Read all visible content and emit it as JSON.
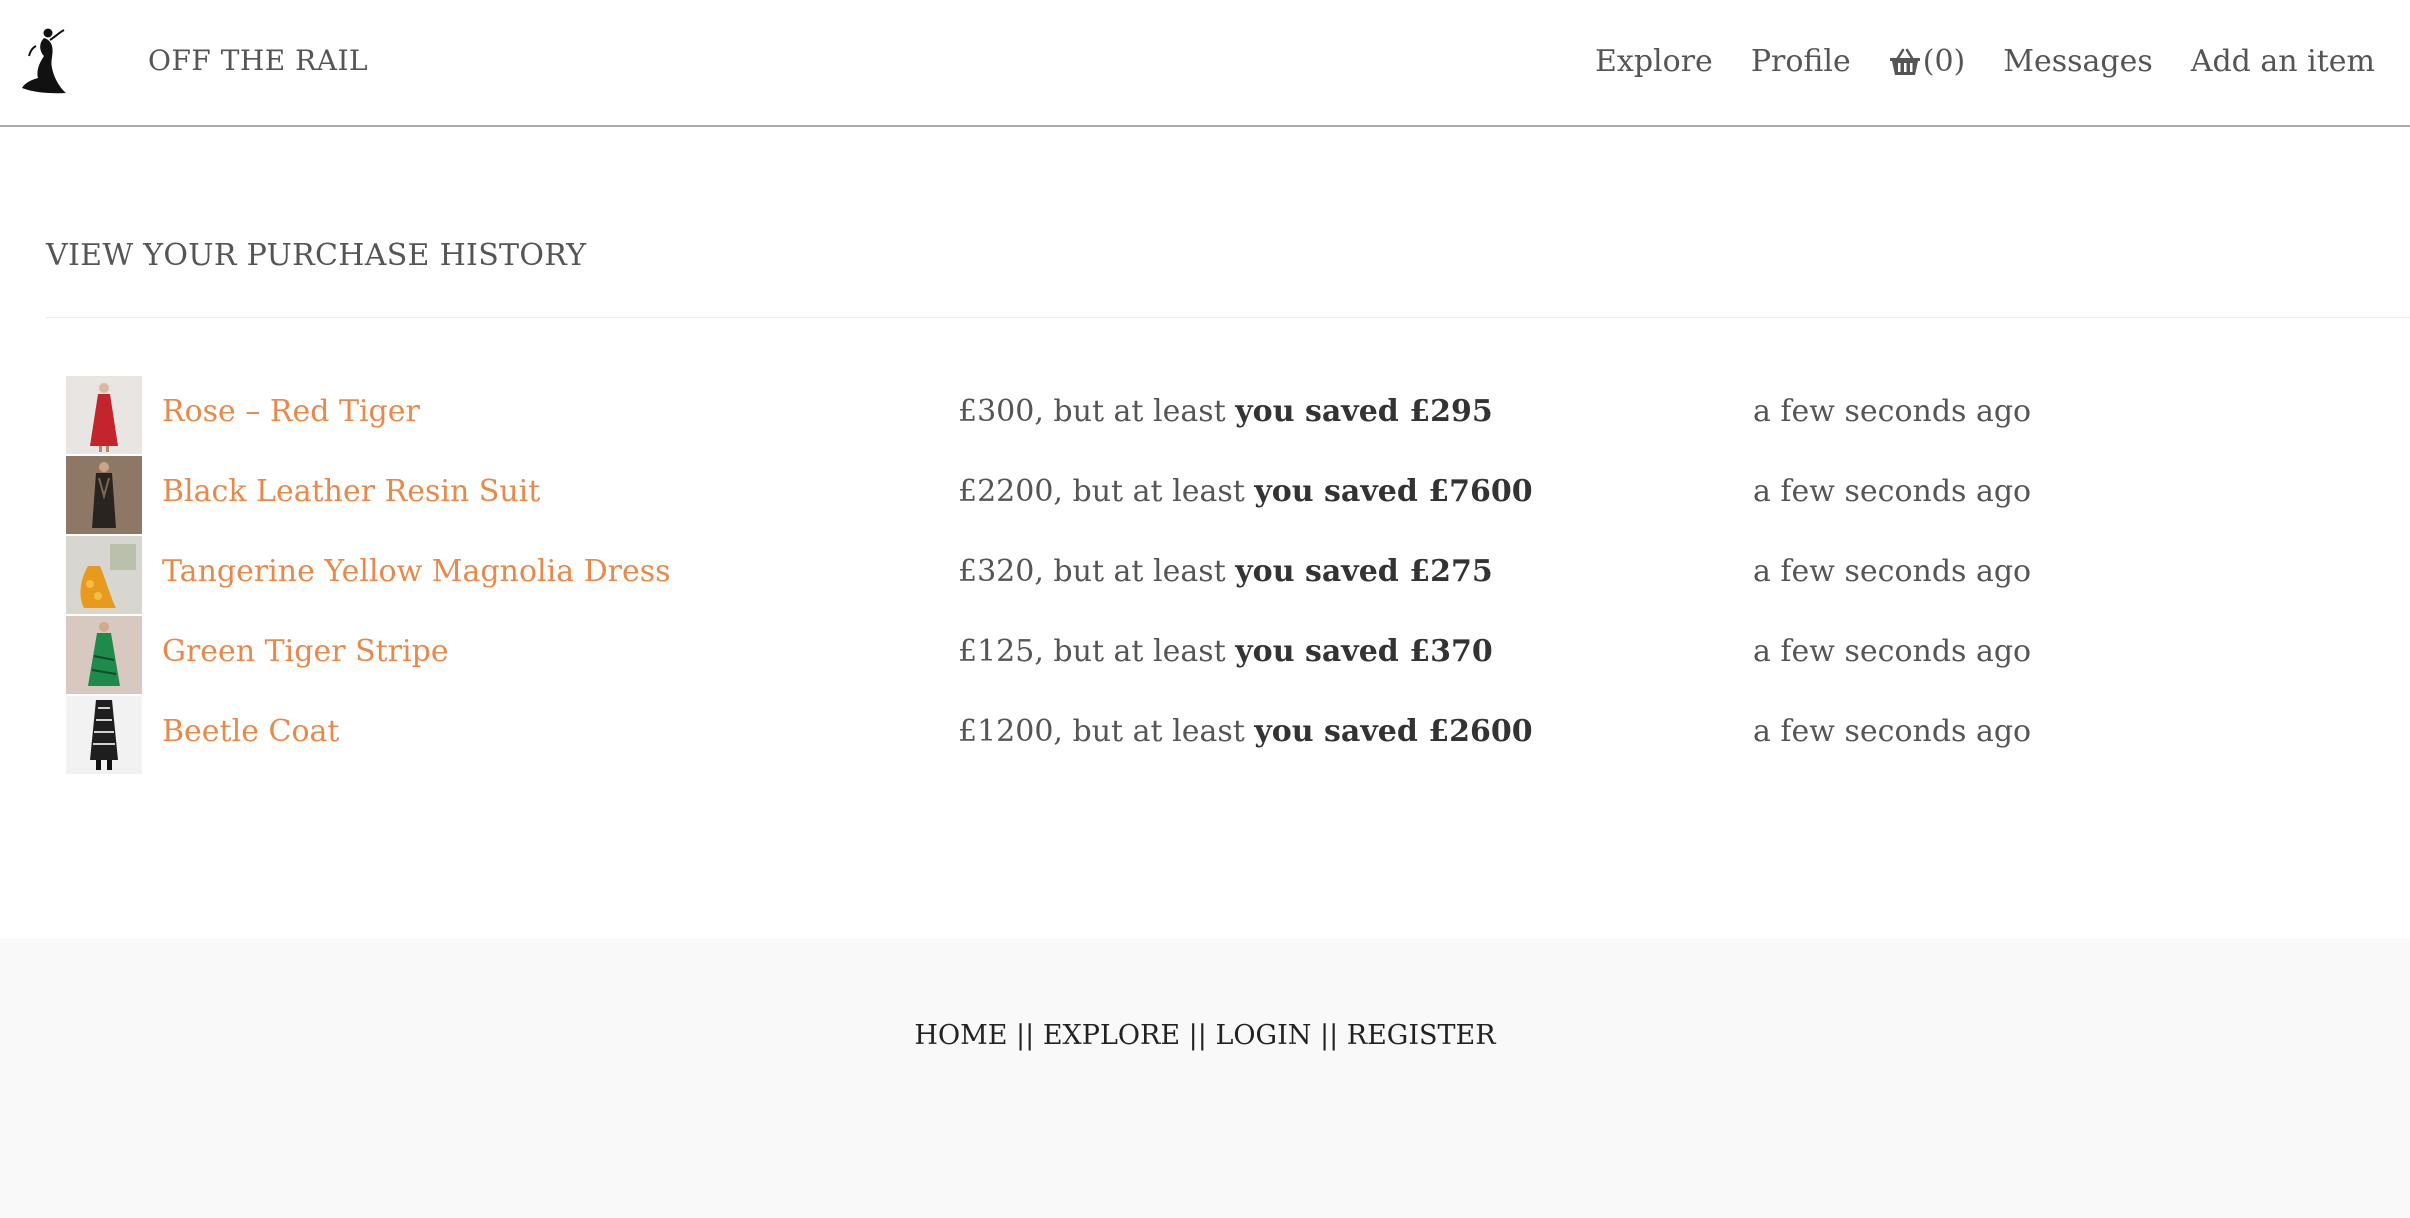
{
  "header": {
    "brand": "OFF THE RAIL",
    "nav": {
      "explore": "Explore",
      "profile": "Profile",
      "basket_count": "(0)",
      "messages": "Messages",
      "add_item": "Add an item"
    },
    "basket_icon": "basket-icon"
  },
  "main": {
    "title": "VIEW YOUR PURCHASE HISTORY",
    "purchases": [
      {
        "name": "Rose – Red Tiger",
        "price": "£300, but at least",
        "saved": "you saved £295",
        "time": "a few seconds ago"
      },
      {
        "name": "Black Leather Resin Suit",
        "price": "£2200, but at least",
        "saved": "you saved £7600",
        "time": "a few seconds ago"
      },
      {
        "name": "Tangerine Yellow Magnolia Dress",
        "price": "£320, but at least",
        "saved": "you saved £275",
        "time": "a few seconds ago"
      },
      {
        "name": "Green Tiger Stripe",
        "price": "£125, but at least",
        "saved": "you saved £370",
        "time": "a few seconds ago"
      },
      {
        "name": "Beetle Coat",
        "price": "£1200, but at least",
        "saved": "you saved £2600",
        "time": "a few seconds ago"
      }
    ]
  },
  "footer": {
    "home": "HOME",
    "explore": "EXPLORE",
    "login": "LOGIN",
    "register": "REGISTER",
    "separator": "||"
  },
  "colors": {
    "accent": "#e8894a",
    "text": "#555555",
    "footer_bg": "#f9f9f9"
  }
}
